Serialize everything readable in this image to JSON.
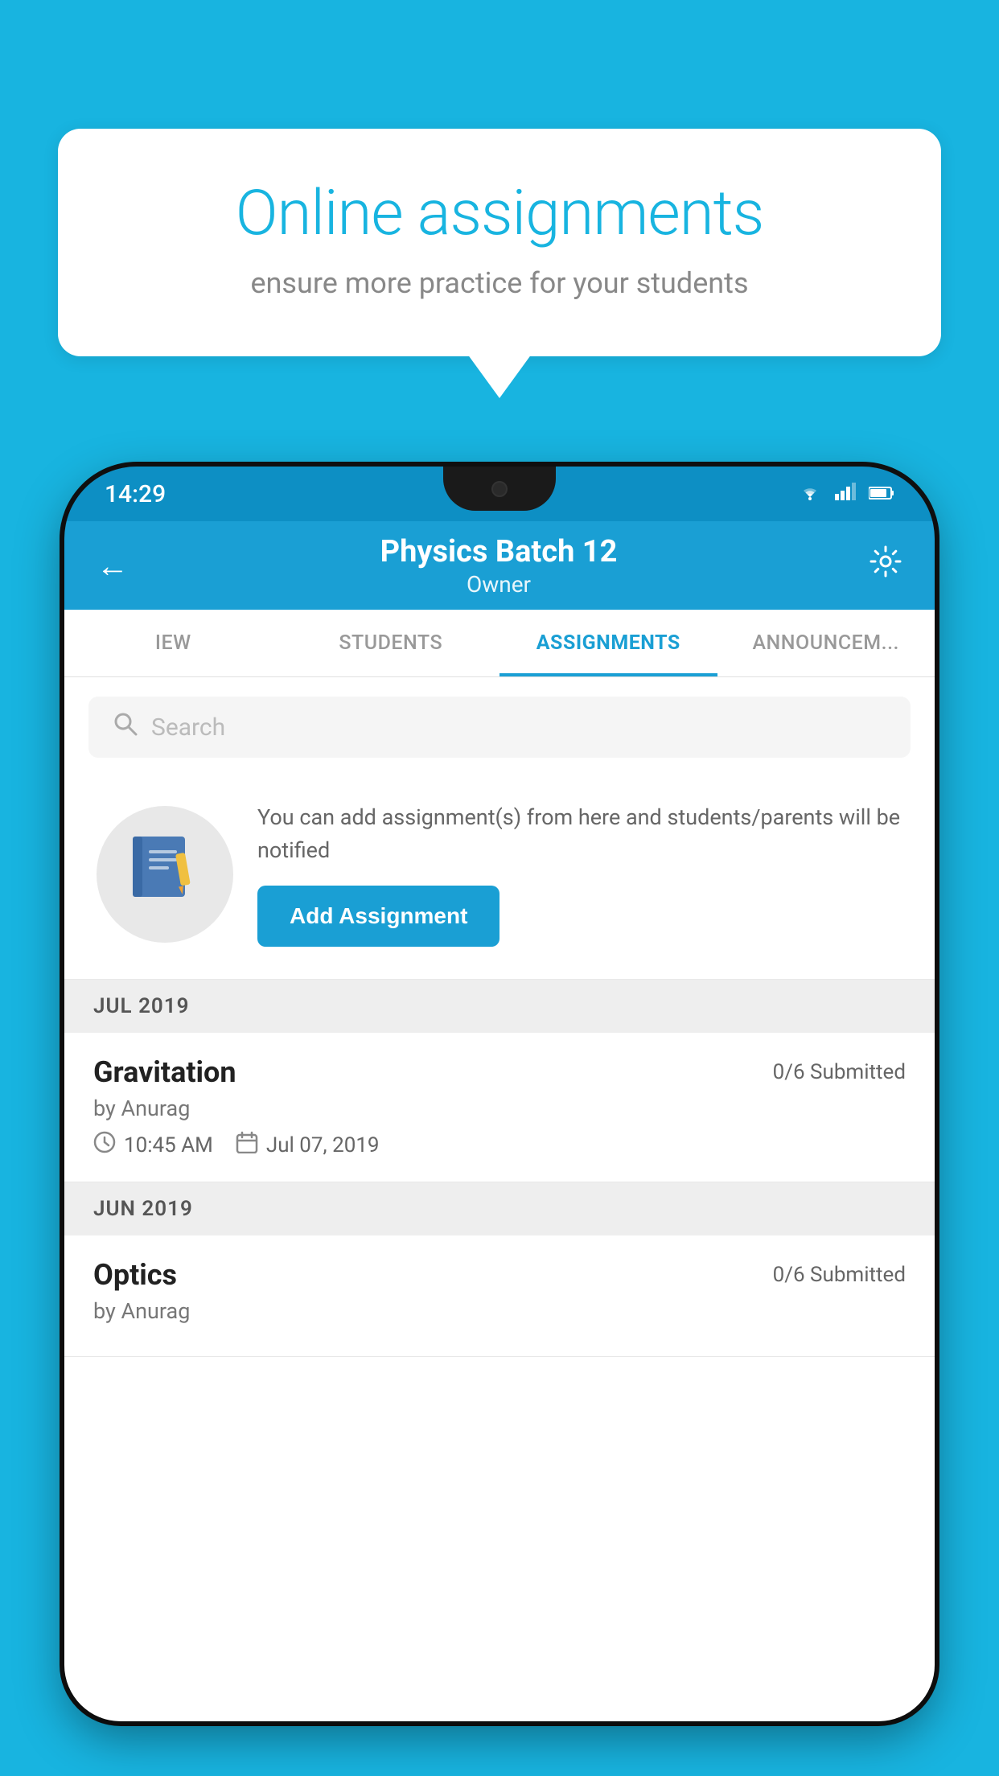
{
  "background": {
    "color": "#18b4e0"
  },
  "speechBubble": {
    "title": "Online assignments",
    "subtitle": "ensure more practice for your students"
  },
  "statusBar": {
    "time": "14:29",
    "icons": [
      "wifi",
      "signal",
      "battery"
    ]
  },
  "appHeader": {
    "title": "Physics Batch 12",
    "subtitle": "Owner",
    "backIcon": "←",
    "settingsIcon": "⚙"
  },
  "tabs": [
    {
      "label": "IEW",
      "active": false
    },
    {
      "label": "STUDENTS",
      "active": false
    },
    {
      "label": "ASSIGNMENTS",
      "active": true
    },
    {
      "label": "ANNOUNCEM...",
      "active": false
    }
  ],
  "search": {
    "placeholder": "Search"
  },
  "promoCard": {
    "description": "You can add assignment(s) from here and students/parents will be notified",
    "buttonLabel": "Add Assignment"
  },
  "sections": [
    {
      "month": "JUL 2019",
      "assignments": [
        {
          "name": "Gravitation",
          "submitted": "0/6 Submitted",
          "by": "by Anurag",
          "time": "10:45 AM",
          "date": "Jul 07, 2019"
        }
      ]
    },
    {
      "month": "JUN 2019",
      "assignments": [
        {
          "name": "Optics",
          "submitted": "0/6 Submitted",
          "by": "by Anurag",
          "time": "",
          "date": ""
        }
      ]
    }
  ]
}
